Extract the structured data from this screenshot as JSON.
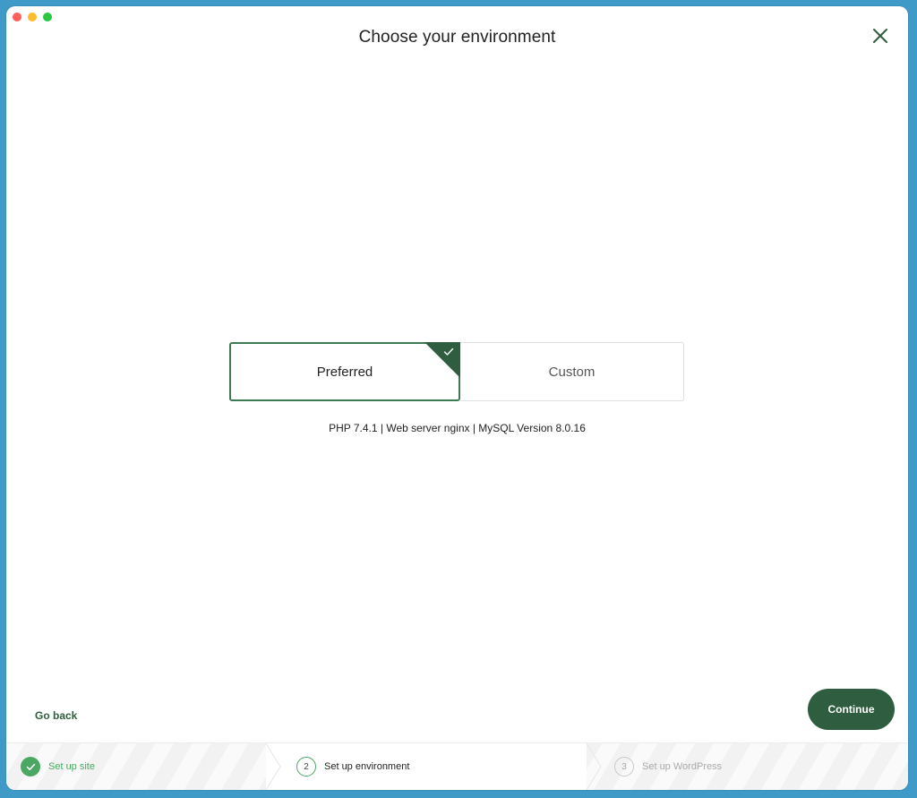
{
  "window": {
    "title": "Choose your environment"
  },
  "options": {
    "preferred_label": "Preferred",
    "custom_label": "Custom",
    "selected": "Preferred"
  },
  "environment_info": "PHP 7.4.1 | Web server nginx | MySQL Version 8.0.16",
  "actions": {
    "go_back": "Go back",
    "continue": "Continue"
  },
  "steps": [
    {
      "number": "1",
      "label": "Set up site",
      "state": "done"
    },
    {
      "number": "2",
      "label": "Set up environment",
      "state": "current"
    },
    {
      "number": "3",
      "label": "Set up WordPress",
      "state": "upcoming"
    }
  ],
  "colors": {
    "accent_dark_green": "#2f5d3f",
    "accent_green": "#4aa862",
    "background_blue": "#3f9ac7"
  }
}
